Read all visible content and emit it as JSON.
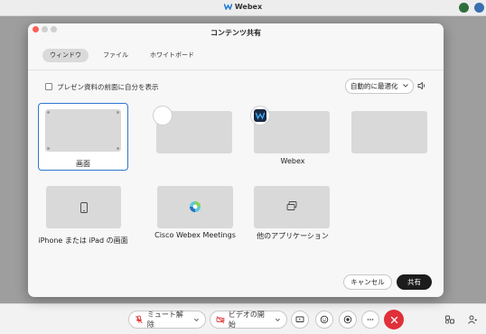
{
  "app": {
    "title": "Webex"
  },
  "dialog": {
    "title": "コンテンツ共有",
    "tabs": [
      {
        "label": "ウィンドウ",
        "active": true
      },
      {
        "label": "ファイル",
        "active": false
      },
      {
        "label": "ホワイトボード",
        "active": false
      }
    ],
    "checkbox_label": "プレゼン資料の前面に自分を表示",
    "checkbox_checked": false,
    "optimize_dropdown": {
      "selected": "自動的に最適化"
    },
    "tiles": [
      {
        "label": "画面",
        "selected": true
      },
      {
        "label": "",
        "selected": false
      },
      {
        "label": "Webex",
        "selected": false
      },
      {
        "label": "",
        "selected": false
      },
      {
        "label": "iPhone または iPad の画面",
        "selected": false
      },
      {
        "label": "Cisco Webex Meetings",
        "selected": false
      },
      {
        "label": "他のアプリケーション",
        "selected": false
      }
    ],
    "cancel_label": "キャンセル",
    "share_label": "共有"
  },
  "controls": {
    "mute_label": "ミュート解除",
    "video_label": "ビデオの開始"
  },
  "colors": {
    "accent_selection": "#2e77d0",
    "end_call": "#e0303a",
    "share_button": "#1c1c1c"
  },
  "icons": [
    "webex-logo-icon",
    "mic-muted-icon",
    "video-off-icon",
    "share-screen-icon",
    "reactions-icon",
    "record-icon",
    "more-icon",
    "end-call-icon",
    "participants-icon",
    "chat-icon",
    "speaker-icon",
    "phone-icon",
    "apps-icon"
  ]
}
